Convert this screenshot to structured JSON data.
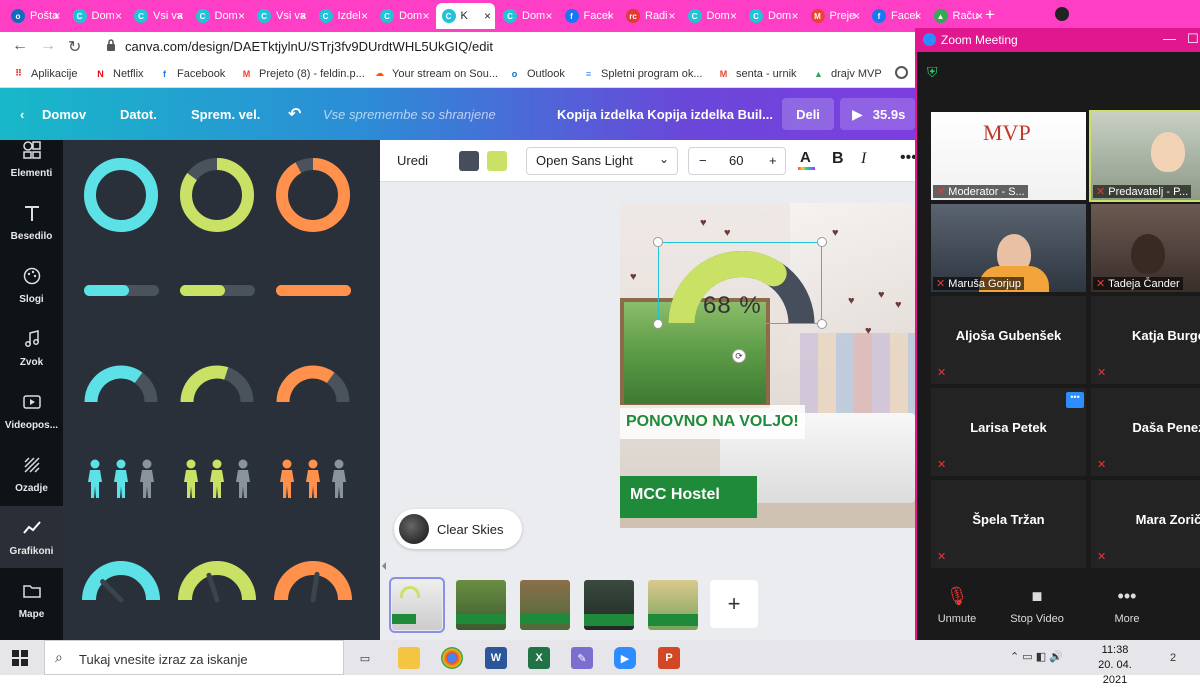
{
  "browser": {
    "tabs": [
      {
        "label": "Pošta",
        "icon": "outlook-icon",
        "color": "#0f6cbd",
        "glyph": "o"
      },
      {
        "label": "Dom",
        "icon": "canva-icon",
        "color": "#20c4d6",
        "glyph": "C"
      },
      {
        "label": "Vsi va",
        "icon": "canva-icon",
        "color": "#20c4d6",
        "glyph": "C"
      },
      {
        "label": "Dom",
        "icon": "canva-icon",
        "color": "#20c4d6",
        "glyph": "C"
      },
      {
        "label": "Vsi va",
        "icon": "canva-icon",
        "color": "#20c4d6",
        "glyph": "C"
      },
      {
        "label": "Izdel",
        "icon": "canva-icon",
        "color": "#20c4d6",
        "glyph": "C"
      },
      {
        "label": "Dom",
        "icon": "canva-icon",
        "color": "#20c4d6",
        "glyph": "C"
      },
      {
        "label": "K",
        "icon": "canva-icon",
        "color": "#20c4d6",
        "glyph": "C",
        "active": true
      },
      {
        "label": "Dom",
        "icon": "canva-icon",
        "color": "#20c4d6",
        "glyph": "C"
      },
      {
        "label": "Facel",
        "icon": "facebook-icon",
        "color": "#1877f2",
        "glyph": "f"
      },
      {
        "label": "Radi",
        "icon": "radio-icon",
        "color": "#e53935",
        "glyph": "rc"
      },
      {
        "label": "Dom",
        "icon": "canva-icon",
        "color": "#20c4d6",
        "glyph": "C"
      },
      {
        "label": "Dom",
        "icon": "canva-icon",
        "color": "#20c4d6",
        "glyph": "C"
      },
      {
        "label": "Preje",
        "icon": "gmail-icon",
        "color": "#ea4335",
        "glyph": "M"
      },
      {
        "label": "Facel",
        "icon": "facebook-icon",
        "color": "#1877f2",
        "glyph": "f"
      },
      {
        "label": "Raču",
        "icon": "drive-icon",
        "color": "#34a853",
        "glyph": "▲"
      }
    ],
    "new_tab": "+",
    "url": "canva.com/design/DAETktjylnU/STrj3fv9DUrdtWHL5UkGIQ/edit",
    "bookmarks": [
      {
        "label": "Aplikacije",
        "icon": "apps-grid-icon",
        "color": "#e53935",
        "glyph": "⠿"
      },
      {
        "label": "Netflix",
        "icon": "netflix-icon",
        "color": "#e50914",
        "glyph": "N"
      },
      {
        "label": "Facebook",
        "icon": "facebook-icon",
        "color": "#1877f2",
        "glyph": "f"
      },
      {
        "label": "Prejeto (8) - feldin.p...",
        "icon": "gmail-icon",
        "color": "#ea4335",
        "glyph": "M"
      },
      {
        "label": "Your stream on Sou...",
        "icon": "soundcloud-icon",
        "color": "#ff5500",
        "glyph": "☁"
      },
      {
        "label": "Outlook",
        "icon": "outlook-icon",
        "color": "#0f6cbd",
        "glyph": "o"
      },
      {
        "label": "Spletni program ok...",
        "icon": "docs-icon",
        "color": "#4285f4",
        "glyph": "≡"
      },
      {
        "label": "senta - urnik",
        "icon": "gmail-icon",
        "color": "#ea4335",
        "glyph": "M"
      },
      {
        "label": "drajv MVP",
        "icon": "drive-icon",
        "color": "#34a853",
        "glyph": "▲"
      }
    ]
  },
  "canva": {
    "header": {
      "home": "Domov",
      "file": "Datot.",
      "resize": "Sprem. vel.",
      "saved": "Vse spremembe so shranjene",
      "title": "Kopija izdelka Kopija izdelka Buil...",
      "share": "Deli",
      "play_time": "35.9s"
    },
    "rail": [
      {
        "label": "Elementi",
        "icon": "shapes-icon"
      },
      {
        "label": "Besedilo",
        "icon": "text-icon"
      },
      {
        "label": "Slogi",
        "icon": "palette-icon"
      },
      {
        "label": "Zvok",
        "icon": "music-note-icon"
      },
      {
        "label": "Videopos...",
        "icon": "video-icon"
      },
      {
        "label": "Ozadje",
        "icon": "background-pattern-icon"
      },
      {
        "label": "Grafikoni",
        "icon": "chart-line-icon",
        "active": true
      },
      {
        "label": "Mape",
        "icon": "folder-icon"
      }
    ],
    "panel_colors": {
      "cyan": "#5ce1e6",
      "lime": "#c9e265",
      "orange": "#ff914d",
      "track": "#4a525c"
    },
    "toolbar": {
      "edit": "Uredi",
      "color1": "#454e5a",
      "color2": "#c9e265",
      "font": "Open Sans Light",
      "minus": "−",
      "size": "60",
      "plus": "+",
      "bold": "B",
      "italic": "I",
      "more": "•••"
    },
    "design": {
      "progress_value": 68,
      "progress_text": "68 %",
      "banner1": "PONOVNO NA VOLJO!",
      "banner2": "MCC Hostel"
    },
    "audio": {
      "label": "Clear Skies"
    },
    "add_page": "+"
  },
  "zoom": {
    "title": "Zoom Meeting",
    "video_tiles": [
      {
        "name": "Moderator - S..."
      },
      {
        "name": "Predavatelj - P..."
      },
      {
        "name": "Maruša Gorjup"
      },
      {
        "name": "Tadeja Čander"
      }
    ],
    "name_tiles": [
      {
        "name": "Aljoša Gubenšek"
      },
      {
        "name": "Katja Burge"
      },
      {
        "name": "Larisa Petek"
      },
      {
        "name": "Daša Penez"
      },
      {
        "name": "Špela  Tržan"
      },
      {
        "name": "Mara Zorič"
      }
    ],
    "controls": {
      "unmute": "Unmute",
      "stop_video": "Stop Video",
      "more": "More"
    }
  },
  "taskbar": {
    "search_placeholder": "Tukaj vnesite izraz za iskanje",
    "time": "11:38",
    "date": "20. 04. 2021",
    "notifications": "2"
  }
}
